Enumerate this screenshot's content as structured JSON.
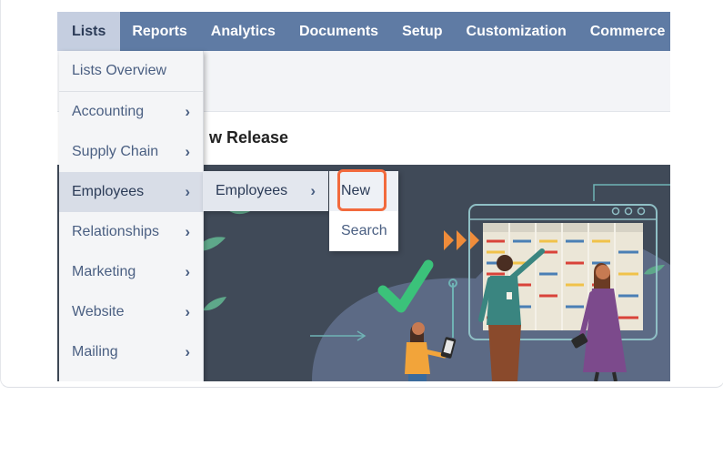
{
  "navbar": {
    "items": [
      {
        "label": "Lists",
        "active": true
      },
      {
        "label": "Reports"
      },
      {
        "label": "Analytics"
      },
      {
        "label": "Documents"
      },
      {
        "label": "Setup"
      },
      {
        "label": "Customization"
      },
      {
        "label": "Commerce"
      }
    ]
  },
  "lists_menu": {
    "items": [
      {
        "label": "Lists Overview"
      },
      {
        "label": "Accounting"
      },
      {
        "label": "Supply Chain"
      },
      {
        "label": "Employees",
        "active": true
      },
      {
        "label": "Relationships"
      },
      {
        "label": "Marketing"
      },
      {
        "label": "Website"
      },
      {
        "label": "Mailing"
      }
    ]
  },
  "employees_menu": {
    "items": [
      {
        "label": "Employees"
      }
    ]
  },
  "action_menu": {
    "items": [
      {
        "label": "New",
        "highlighted": true
      },
      {
        "label": "Search"
      }
    ]
  },
  "page": {
    "release_title": "w Release"
  },
  "colors": {
    "nav_bg": "#5f7ba4",
    "nav_active_bg": "#c5cee0",
    "highlight": "#f26a3d",
    "banner_bg": "#404a58",
    "check": "#3bc27a"
  },
  "icons": [
    "chevron-right-icon",
    "checkmark-icon",
    "play-arrows-icon"
  ]
}
